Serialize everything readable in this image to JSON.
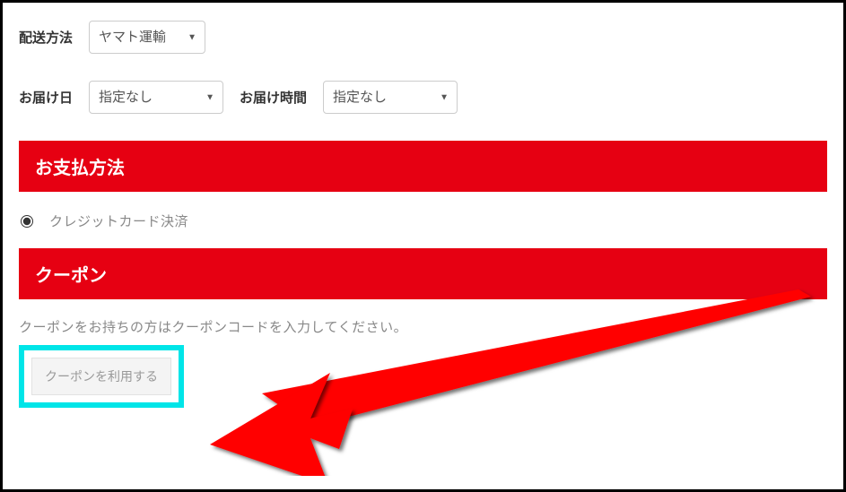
{
  "shipping": {
    "method_label": "配送方法",
    "method_value": "ヤマト運輸",
    "date_label": "お届け日",
    "date_value": "指定なし",
    "time_label": "お届け時間",
    "time_value": "指定なし"
  },
  "payment": {
    "header": "お支払方法",
    "option": "クレジットカード決済"
  },
  "coupon": {
    "header": "クーポン",
    "instruction": "クーポンをお持ちの方はクーポンコードを入力してください。",
    "button": "クーポンを利用する"
  },
  "colors": {
    "accent_red": "#e60012",
    "highlight": "#00e5e8"
  }
}
